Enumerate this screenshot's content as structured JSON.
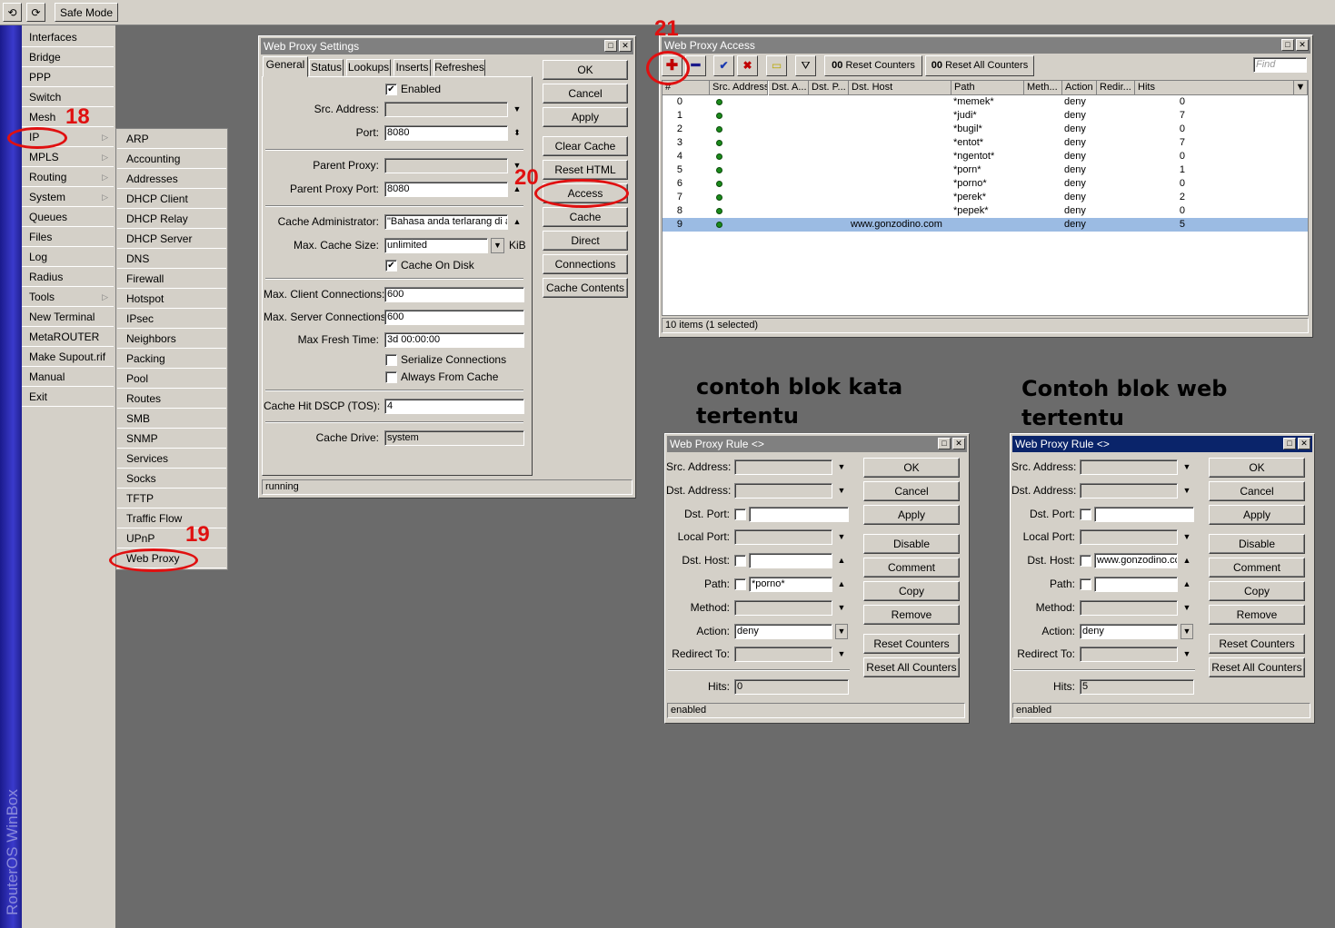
{
  "topbar": {
    "undo": "⟲",
    "redo": "⟳",
    "safe_mode": "Safe Mode"
  },
  "brand": "RouterOS WinBox",
  "sidebar": [
    "Interfaces",
    "Bridge",
    "PPP",
    "Switch",
    "Mesh",
    "IP",
    "MPLS",
    "Routing",
    "System",
    "Queues",
    "Files",
    "Log",
    "Radius",
    "Tools",
    "New Terminal",
    "MetaROUTER",
    "Make Supout.rif",
    "Manual",
    "Exit"
  ],
  "ip_submenu": [
    "ARP",
    "Accounting",
    "Addresses",
    "DHCP Client",
    "DHCP Relay",
    "DHCP Server",
    "DNS",
    "Firewall",
    "Hotspot",
    "IPsec",
    "Neighbors",
    "Packing",
    "Pool",
    "Routes",
    "SMB",
    "SNMP",
    "Services",
    "Socks",
    "TFTP",
    "Traffic Flow",
    "UPnP",
    "Web Proxy"
  ],
  "annotations": {
    "n18": "18",
    "n19": "19",
    "n20": "20",
    "n21": "21"
  },
  "captions": {
    "c1": "contoh blok kata tertentu",
    "c2": "Contoh blok web tertentu"
  },
  "settings": {
    "title": "Web Proxy Settings",
    "tabs": [
      "General",
      "Status",
      "Lookups",
      "Inserts",
      "Refreshes"
    ],
    "enabled": "Enabled",
    "src_address": "Src. Address:",
    "port_label": "Port:",
    "port": "8080",
    "parent_proxy": "Parent Proxy:",
    "parent_proxy_port_label": "Parent Proxy Port:",
    "parent_proxy_port": "8080",
    "cache_admin_label": "Cache Administrator:",
    "cache_admin": "\"Bahasa anda terlarang di a",
    "max_cache_label": "Max. Cache Size:",
    "max_cache": "unlimited",
    "kib": "KiB",
    "cache_on_disk": "Cache On Disk",
    "max_client_label": "Max. Client Connections:",
    "max_client": "600",
    "max_server_label": "Max. Server Connections:",
    "max_server": "600",
    "max_fresh_label": "Max Fresh Time:",
    "max_fresh": "3d 00:00:00",
    "serialize": "Serialize Connections",
    "always_cache": "Always From Cache",
    "dscp_label": "Cache Hit DSCP (TOS):",
    "dscp": "4",
    "drive_label": "Cache Drive:",
    "drive": "system",
    "buttons": [
      "OK",
      "Cancel",
      "Apply",
      "Clear Cache",
      "Reset HTML",
      "Access",
      "Cache",
      "Direct",
      "Connections",
      "Cache Contents"
    ],
    "status": "running"
  },
  "access": {
    "title": "Web Proxy Access",
    "reset_counters": "Reset Counters",
    "reset_all_counters": "Reset All Counters",
    "oo": "00",
    "find": "Find",
    "columns": [
      "#",
      "Src. Address",
      "Dst. A...",
      "Dst. P...",
      "Dst. Host",
      "Path",
      "Meth...",
      "Action",
      "Redir...",
      "Hits"
    ],
    "rows": [
      {
        "n": "0",
        "host": "",
        "path": "*memek*",
        "action": "deny",
        "hits": "0"
      },
      {
        "n": "1",
        "host": "",
        "path": "*judi*",
        "action": "deny",
        "hits": "7"
      },
      {
        "n": "2",
        "host": "",
        "path": "*bugil*",
        "action": "deny",
        "hits": "0"
      },
      {
        "n": "3",
        "host": "",
        "path": "*entot*",
        "action": "deny",
        "hits": "7"
      },
      {
        "n": "4",
        "host": "",
        "path": "*ngentot*",
        "action": "deny",
        "hits": "0"
      },
      {
        "n": "5",
        "host": "",
        "path": "*porn*",
        "action": "deny",
        "hits": "1"
      },
      {
        "n": "6",
        "host": "",
        "path": "*porno*",
        "action": "deny",
        "hits": "0"
      },
      {
        "n": "7",
        "host": "",
        "path": "*perek*",
        "action": "deny",
        "hits": "2"
      },
      {
        "n": "8",
        "host": "",
        "path": "*pepek*",
        "action": "deny",
        "hits": "0"
      },
      {
        "n": "9",
        "host": "www.gonzodino.com",
        "path": "",
        "action": "deny",
        "hits": "5"
      }
    ],
    "status": "10 items (1 selected)"
  },
  "rule_labels": [
    "Src. Address:",
    "Dst. Address:",
    "Dst. Port:",
    "Local Port:",
    "Dst. Host:",
    "Path:",
    "Method:",
    "Action:",
    "Redirect To:",
    "Hits:"
  ],
  "rule_buttons": [
    "OK",
    "Cancel",
    "Apply",
    "Disable",
    "Comment",
    "Copy",
    "Remove",
    "Reset Counters",
    "Reset All Counters"
  ],
  "rule1": {
    "title": "Web Proxy Rule <>",
    "dst_host": "",
    "path": "*porno*",
    "action": "deny",
    "hits": "0",
    "status": "enabled"
  },
  "rule2": {
    "title": "Web Proxy Rule <>",
    "dst_host": "www.gonzodino.cc",
    "path": "",
    "action": "deny",
    "hits": "5",
    "status": "enabled"
  }
}
